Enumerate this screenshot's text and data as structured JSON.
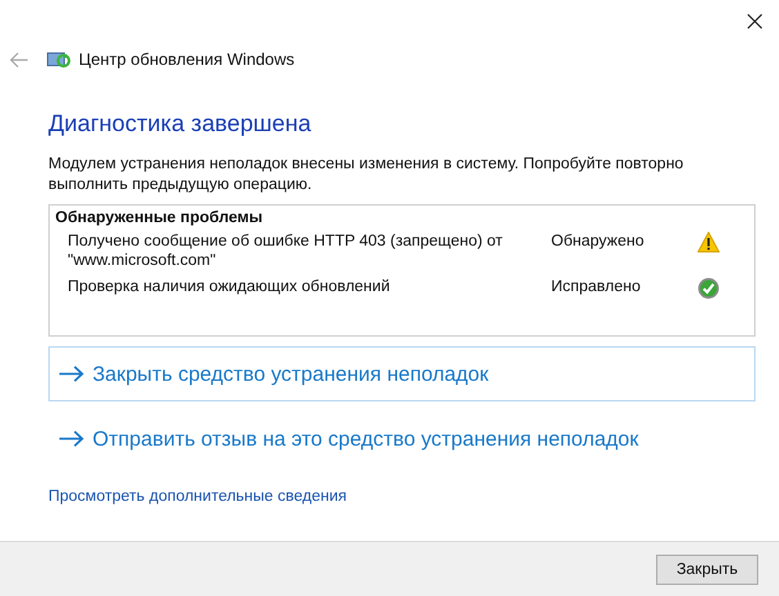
{
  "window": {
    "title": "Центр обновления Windows"
  },
  "heading": "Диагностика завершена",
  "description": "Модулем устранения неполадок внесены изменения в систему. Попробуйте повторно выполнить предыдущую операцию.",
  "problems": {
    "title": "Обнаруженные проблемы",
    "rows": [
      {
        "text": "Получено сообщение об ошибке HTTP 403 (запрещено) от \"www.microsoft.com\"",
        "status": "Обнаружено",
        "kind": "warning"
      },
      {
        "text": "Проверка наличия ожидающих обновлений",
        "status": "Исправлено",
        "kind": "fixed"
      }
    ]
  },
  "commands": [
    {
      "label": "Закрыть средство устранения неполадок",
      "selected": true
    },
    {
      "label": "Отправить отзыв на это средство устранения неполадок",
      "selected": false
    }
  ],
  "more_link": "Просмотреть дополнительные сведения",
  "buttons": [
    "Закрыть"
  ]
}
